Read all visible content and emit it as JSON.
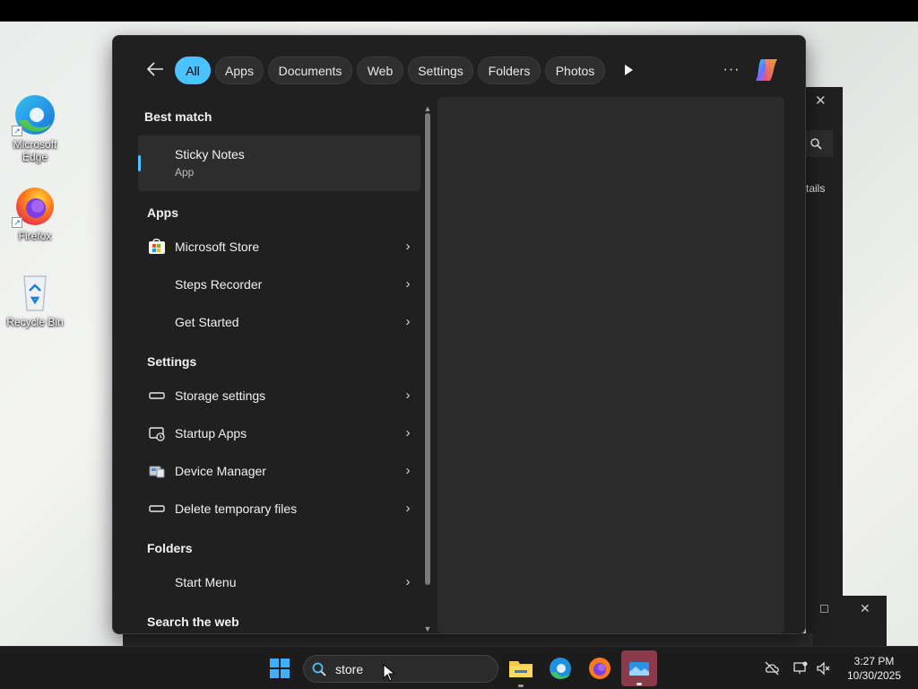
{
  "desktop": {
    "icons": [
      {
        "label": "Microsoft Edge"
      },
      {
        "label": "Firefox"
      },
      {
        "label": "Recycle Bin"
      }
    ]
  },
  "background_window": {
    "partial_label": "tails"
  },
  "search": {
    "filters": [
      {
        "label": "All",
        "active": true
      },
      {
        "label": "Apps",
        "active": false
      },
      {
        "label": "Documents",
        "active": false
      },
      {
        "label": "Web",
        "active": false
      },
      {
        "label": "Settings",
        "active": false
      },
      {
        "label": "Folders",
        "active": false
      },
      {
        "label": "Photos",
        "active": false
      }
    ],
    "more_label": "···",
    "best_match": {
      "header": "Best match",
      "title": "Sticky Notes",
      "subtitle": "App"
    },
    "sections": [
      {
        "header": "Apps",
        "items": [
          {
            "label": "Microsoft Store",
            "icon": "store-icon"
          },
          {
            "label": "Steps Recorder",
            "icon": "blank-icon"
          },
          {
            "label": "Get Started",
            "icon": "blank-icon"
          }
        ]
      },
      {
        "header": "Settings",
        "items": [
          {
            "label": "Storage settings",
            "icon": "storage-icon"
          },
          {
            "label": "Startup Apps",
            "icon": "startup-apps-icon"
          },
          {
            "label": "Device Manager",
            "icon": "device-manager-icon"
          },
          {
            "label": "Delete temporary files",
            "icon": "storage-icon"
          }
        ]
      },
      {
        "header": "Folders",
        "items": [
          {
            "label": "Start Menu",
            "icon": "blank-icon"
          }
        ]
      },
      {
        "header": "Search the web",
        "items": []
      }
    ]
  },
  "taskbar": {
    "search_value": "store",
    "clock": {
      "time": "3:27 PM",
      "date": "10/30/2025"
    }
  },
  "colors": {
    "accent": "#4cc2ff",
    "flyout_bg": "#202020",
    "taskbar_bg": "#1c1c1c"
  }
}
